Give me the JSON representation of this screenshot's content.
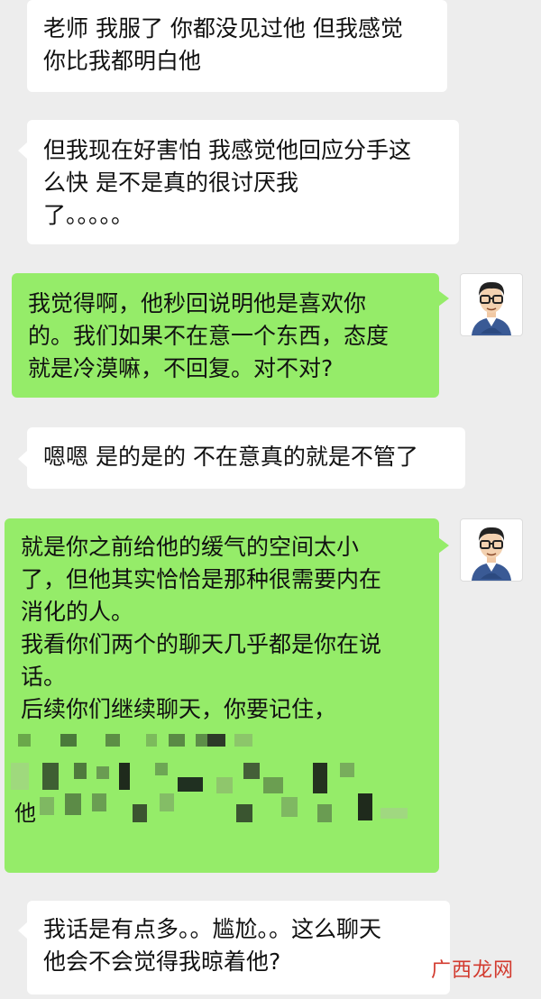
{
  "messages": [
    {
      "side": "left",
      "lines": [
        "老师 我服了 你都没见过他 但我感觉",
        "你比我都明白他"
      ]
    },
    {
      "side": "left",
      "lines": [
        "但我现在好害怕 我感觉他回应分手这",
        "么快  是不是真的很讨厌我",
        "了。。。。。"
      ]
    },
    {
      "side": "right",
      "lines": [
        "我觉得啊，他秒回说明他是喜欢你",
        "的。我们如果不在意一个东西，态度",
        "就是冷漠嘛，不回复。对不对?"
      ]
    },
    {
      "side": "left",
      "lines": [
        "嗯嗯 是的是的 不在意真的就是不管了"
      ]
    },
    {
      "side": "right",
      "lines": [
        "就是你之前给他的缓气的空间太小",
        "了，但他其实恰恰是那种很需要内在",
        "消化的人。",
        "我看你们两个的聊天几乎都是你在说",
        "话。",
        "后续你们继续聊天，你要记住，"
      ],
      "censored_fragment": "他"
    },
    {
      "side": "left",
      "lines": [
        "我话是有点多。。尴尬。。这么聊天",
        "他会不会觉得我晾着他?"
      ]
    }
  ],
  "watermark": "广西龙网",
  "avatar_icon": "teacher-cartoon-avatar",
  "colors": {
    "background": "#ededed",
    "incoming_bubble": "#ffffff",
    "outgoing_bubble": "#95ec69",
    "watermark": "#d23a2e"
  }
}
